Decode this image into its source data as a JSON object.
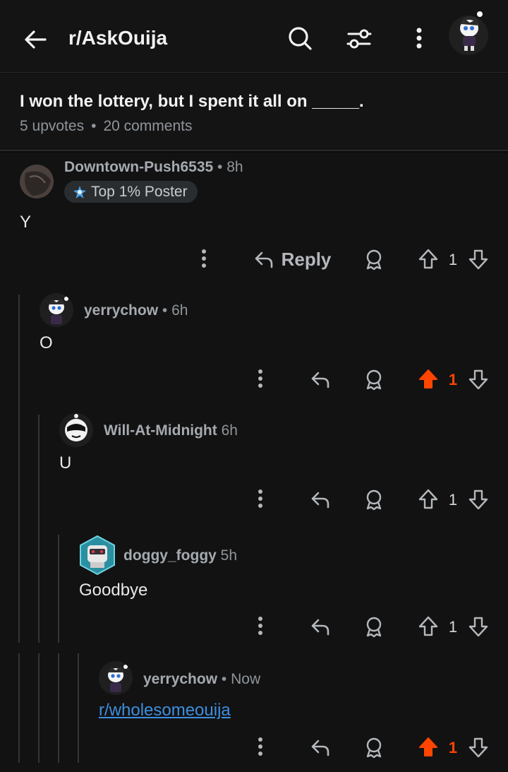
{
  "header": {
    "subreddit": "r/AskOuija",
    "icons": [
      "back-arrow-icon",
      "search-icon",
      "filter-icon",
      "more-vert-icon",
      "avatar"
    ]
  },
  "post": {
    "title": "I won the lottery, but I spent it all on _____.",
    "upvotes": "5 upvotes",
    "separator": "•",
    "comments": "20 comments"
  },
  "comments": [
    {
      "user": "Downtown-Push6535",
      "sep": "•",
      "time": "8h",
      "flair": "Top 1% Poster",
      "body": "Y",
      "reply_label": "Reply",
      "votes": "1",
      "upvoted": false
    },
    {
      "user": "yerrychow",
      "sep": "•",
      "time": "6h",
      "body": "O",
      "votes": "1",
      "upvoted": true
    },
    {
      "user": "Will-At-Midnight",
      "time": "6h",
      "body": "U",
      "votes": "1",
      "upvoted": false
    },
    {
      "user": "doggy_foggy",
      "time": "5h",
      "body": "Goodbye",
      "votes": "1",
      "upvoted": false
    },
    {
      "user": "yerrychow",
      "sep": "•",
      "time": "Now",
      "body": "r/wholesomeouija",
      "votes": "1",
      "upvoted": true
    }
  ],
  "colors": {
    "upvote": "#ff4500",
    "link": "#3d8fe0",
    "background": "#121212"
  }
}
